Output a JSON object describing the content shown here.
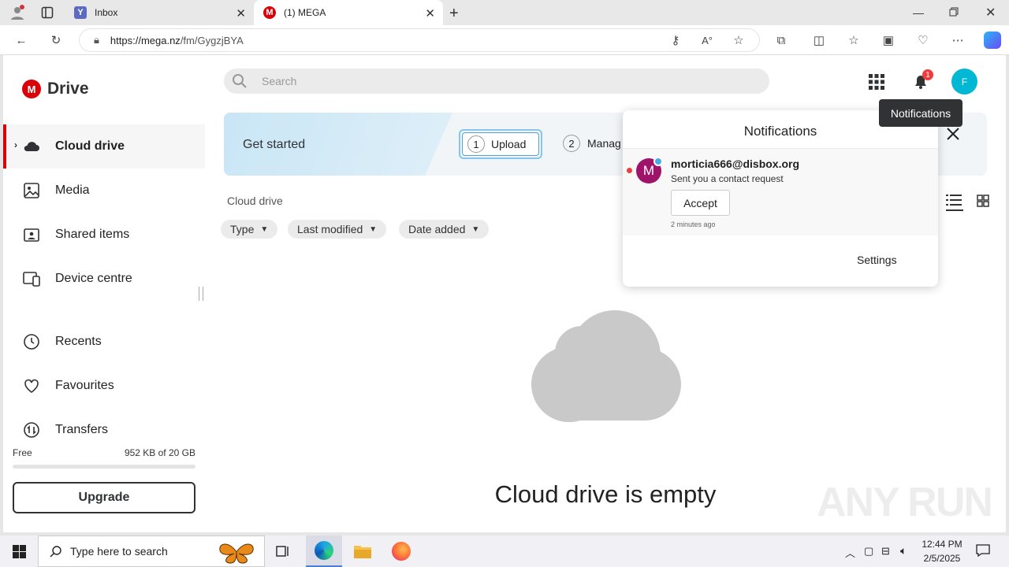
{
  "browser": {
    "tabs": [
      {
        "title": "Inbox",
        "favicon": "Y"
      },
      {
        "title": "(1) MEGA",
        "favicon": "M"
      }
    ],
    "url_host": "https://mega.nz",
    "url_path": "/fm/GygzjBYA"
  },
  "sidebar": {
    "brand": "Drive",
    "items": [
      {
        "label": "Cloud drive",
        "icon": "cloud-icon"
      },
      {
        "label": "Media",
        "icon": "image-icon"
      },
      {
        "label": "Shared items",
        "icon": "shared-folder-icon"
      },
      {
        "label": "Device centre",
        "icon": "devices-icon"
      },
      {
        "label": "Recents",
        "icon": "clock-icon"
      },
      {
        "label": "Favourites",
        "icon": "heart-icon"
      },
      {
        "label": "Transfers",
        "icon": "transfers-icon"
      }
    ],
    "storage": {
      "plan": "Free",
      "usage_text": "952 KB of 20 GB",
      "used_fraction": 0.0
    },
    "upgrade_label": "Upgrade"
  },
  "header": {
    "search_placeholder": "Search",
    "notification_count": "1",
    "avatar_letter": "F",
    "tooltip": "Notifications"
  },
  "banner": {
    "title": "Get started",
    "steps": [
      {
        "num": "1",
        "label": "Upload"
      },
      {
        "num": "2",
        "label": "Manag"
      }
    ]
  },
  "main": {
    "breadcrumb": "Cloud drive",
    "filters": [
      "Type",
      "Last modified",
      "Date added"
    ],
    "empty_text": "Cloud drive is empty"
  },
  "notifications": {
    "title": "Notifications",
    "item": {
      "avatar_letter": "M",
      "email": "morticia666@disbox.org",
      "message": "Sent you a contact request",
      "accept_label": "Accept",
      "time": "2 minutes ago"
    },
    "settings_label": "Settings"
  },
  "watermark": "ANY RUN",
  "taskbar": {
    "search_placeholder": "Type here to search",
    "time": "12:44 PM",
    "date": "2/5/2025"
  },
  "colors": {
    "brand_red": "#d90007",
    "avatar_teal": "#00b8d4",
    "notif_avatar": "#a0136a"
  }
}
